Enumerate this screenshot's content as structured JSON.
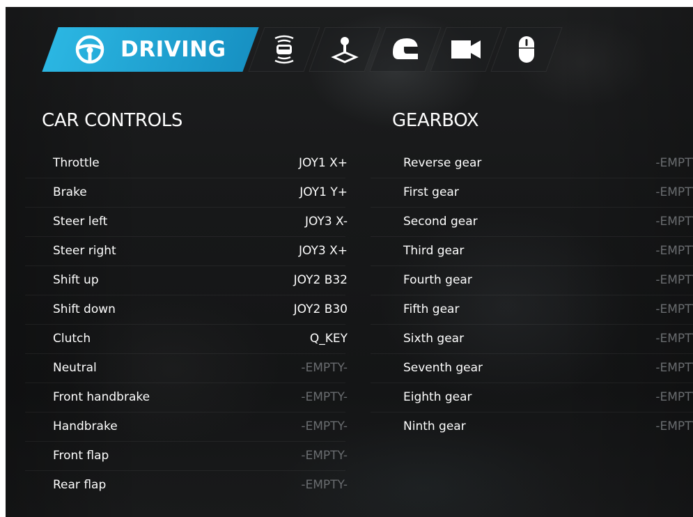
{
  "tabs": [
    {
      "label": "DRIVING",
      "icon": "steering-wheel-icon",
      "active": true
    },
    {
      "label": "",
      "icon": "car-radar-icon",
      "active": false
    },
    {
      "label": "",
      "icon": "joystick-icon",
      "active": false
    },
    {
      "label": "",
      "icon": "helmet-icon",
      "active": false
    },
    {
      "label": "",
      "icon": "camera-icon",
      "active": false
    },
    {
      "label": "",
      "icon": "mouse-icon",
      "active": false
    }
  ],
  "car_controls": {
    "title": "CAR CONTROLS",
    "rows": [
      {
        "label": "Throttle",
        "value": "JOY1 X+",
        "empty": false
      },
      {
        "label": "Brake",
        "value": "JOY1 Y+",
        "empty": false
      },
      {
        "label": "Steer left",
        "value": "JOY3 X-",
        "empty": false
      },
      {
        "label": "Steer right",
        "value": "JOY3 X+",
        "empty": false
      },
      {
        "label": "Shift up",
        "value": "JOY2 B32",
        "empty": false
      },
      {
        "label": "Shift down",
        "value": "JOY2 B30",
        "empty": false
      },
      {
        "label": "Clutch",
        "value": "Q_KEY",
        "empty": false
      },
      {
        "label": "Neutral",
        "value": "-EMPTY-",
        "empty": true
      },
      {
        "label": "Front handbrake",
        "value": "-EMPTY-",
        "empty": true
      },
      {
        "label": "Handbrake",
        "value": "-EMPTY-",
        "empty": true
      },
      {
        "label": "Front flap",
        "value": "-EMPTY-",
        "empty": true
      },
      {
        "label": "Rear flap",
        "value": "-EMPTY-",
        "empty": true
      }
    ]
  },
  "gearbox": {
    "title": "GEARBOX",
    "rows": [
      {
        "label": "Reverse gear",
        "value": "-EMPTY-",
        "empty": true
      },
      {
        "label": "First gear",
        "value": "-EMPTY-",
        "empty": true
      },
      {
        "label": "Second gear",
        "value": "-EMPTY-",
        "empty": true
      },
      {
        "label": "Third gear",
        "value": "-EMPTY-",
        "empty": true
      },
      {
        "label": "Fourth gear",
        "value": "-EMPTY-",
        "empty": true
      },
      {
        "label": "Fifth gear",
        "value": "-EMPTY-",
        "empty": true
      },
      {
        "label": "Sixth gear",
        "value": "-EMPTY-",
        "empty": true
      },
      {
        "label": "Seventh gear",
        "value": "-EMPTY-",
        "empty": true
      },
      {
        "label": "Eighth gear",
        "value": "-EMPTY-",
        "empty": true
      },
      {
        "label": "Ninth gear",
        "value": "-EMPTY-",
        "empty": true
      }
    ]
  },
  "colors": {
    "accent": "#1fa4d6",
    "text": "#ffffff",
    "empty_value": "#6a6d70",
    "background": "#171819"
  }
}
